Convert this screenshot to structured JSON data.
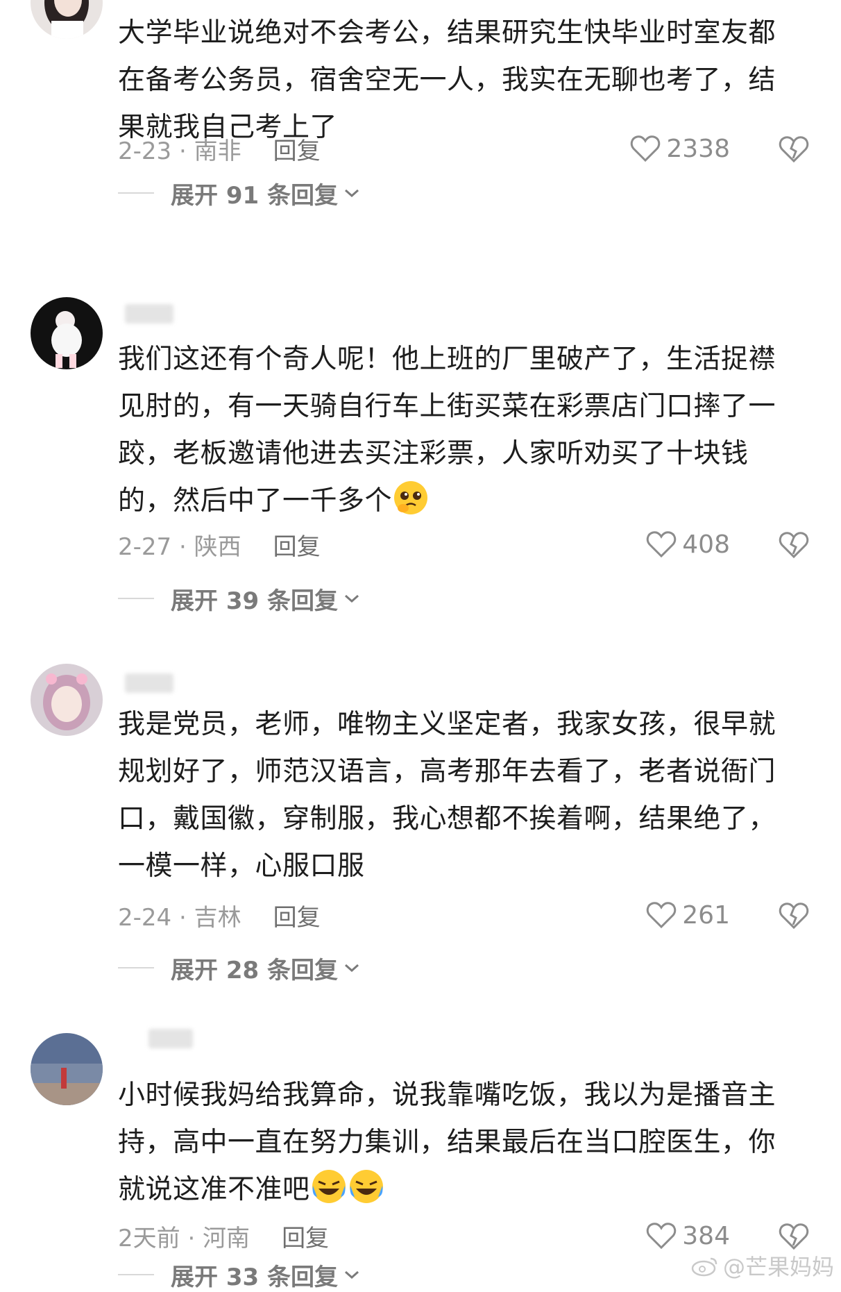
{
  "comments": [
    {
      "text": "大学毕业说绝对不会考公，结果研究生快毕业时室友都\n在备考公务员，宿舍空无一人，我实在无聊也考了，结\n果就我自己考上了",
      "date_location": "2-23 · 南非",
      "reply": "回复",
      "likes": "2338",
      "expand": "展开 91 条回复"
    },
    {
      "text": "我们这还有个奇人呢！他上班的厂里破产了，生活捉襟\n见肘的，有一天骑自行车上街买菜在彩票店门口摔了一\n跤，老板邀请他进去买注彩票，人家听劝买了十块钱\n的，然后中了一千多个",
      "date_location": "2-27 · 陕西",
      "reply": "回复",
      "likes": "408",
      "expand": "展开 39 条回复"
    },
    {
      "text": "我是党员，老师，唯物主义坚定者，我家女孩，很早就\n规划好了，师范汉语言，高考那年去看了，老者说衙门\n口，戴国徽，穿制服，我心想都不挨着啊，结果绝了，\n一模一样，心服口服",
      "date_location": "2-24 · 吉林",
      "reply": "回复",
      "likes": "261",
      "expand": "展开 28 条回复"
    },
    {
      "text": "小时候我妈给我算命，说我靠嘴吃饭，我以为是播音主\n持，高中一直在努力集训，结果最后在当口腔医生，你\n就说这准不准吧",
      "date_location": "2天前 · 河南",
      "reply": "回复",
      "likes": "384",
      "expand": "展开 33 条回复"
    }
  ],
  "watermark": "@芒果妈妈",
  "colors": {
    "text": "#1d1d1d",
    "meta": "#9a9a9a",
    "icon": "#8c8c8c"
  }
}
